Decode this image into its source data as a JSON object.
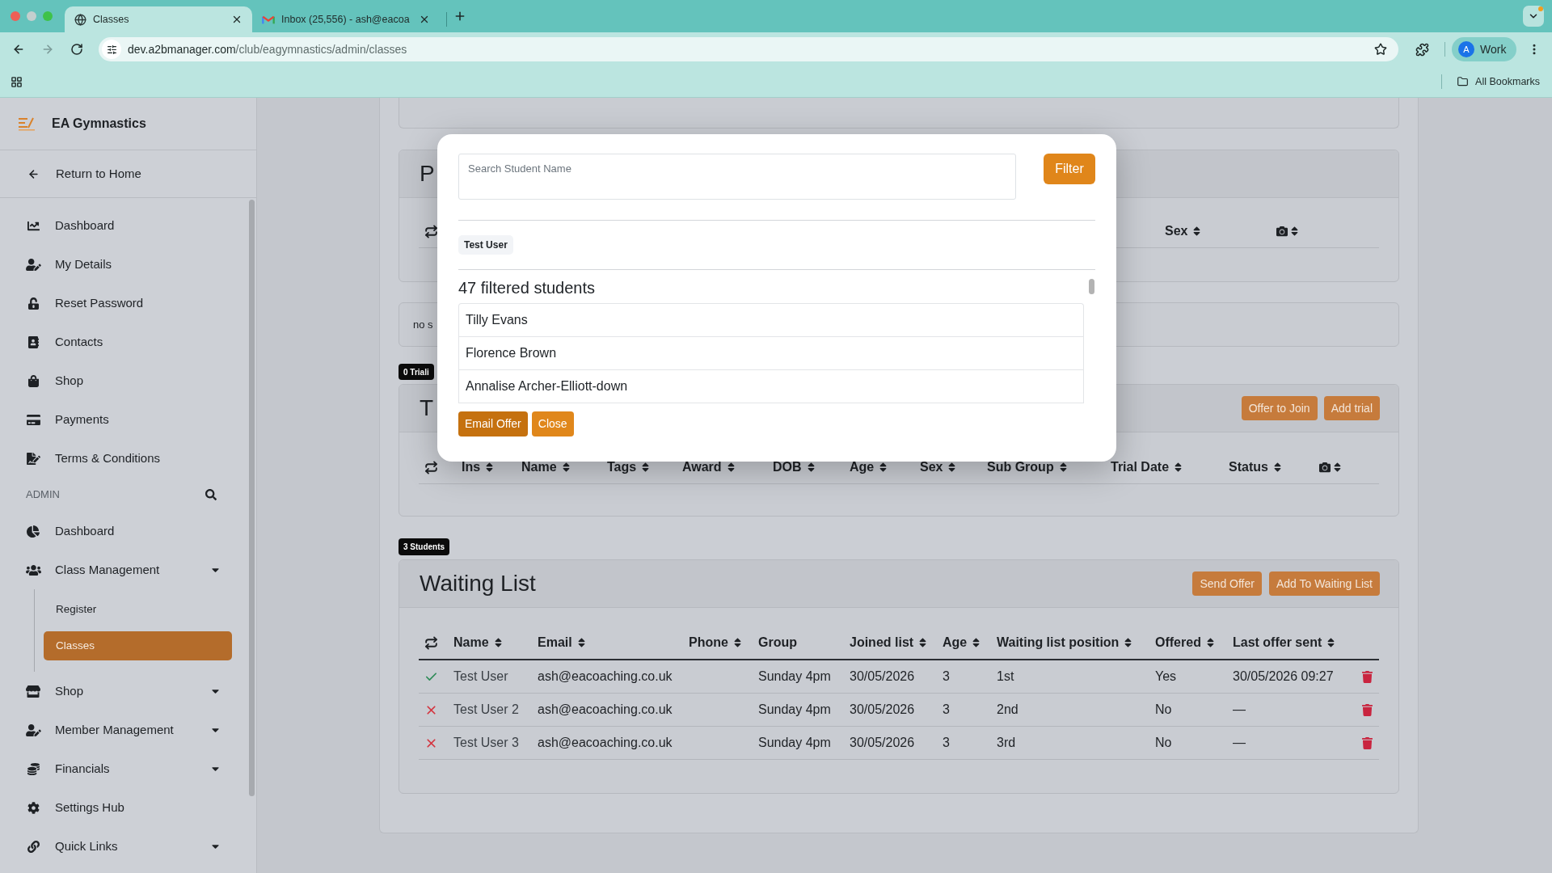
{
  "browser": {
    "tabs": [
      {
        "title": "Classes",
        "selected": true
      },
      {
        "title": "Inbox (25,556) - ash@eacoa",
        "selected": false
      }
    ],
    "url": {
      "host": "dev.a2bmanager.com",
      "path": "/club/eagymnastics/admin/classes"
    },
    "profile": {
      "initial": "A",
      "name": "Work"
    },
    "bookmarks_folder": "All Bookmarks"
  },
  "sidebar": {
    "club_name": "EA Gymnastics",
    "back_link": "Return to Home",
    "items": [
      {
        "label": "Dashboard",
        "selected": false
      },
      {
        "label": "My Details",
        "selected": false
      },
      {
        "label": "Reset Password",
        "selected": false
      },
      {
        "label": "Contacts",
        "selected": false
      },
      {
        "label": "Shop",
        "selected": false
      },
      {
        "label": "Payments",
        "selected": false
      },
      {
        "label": "Terms & Conditions",
        "selected": false
      }
    ],
    "admin_label": "ADMIN",
    "admin_items": [
      {
        "label": "Dashboard",
        "selected": false
      },
      {
        "label": "Class Management",
        "selected": false,
        "expanded": true,
        "children": [
          {
            "label": "Register",
            "selected": false
          },
          {
            "label": "Classes",
            "selected": true
          }
        ]
      },
      {
        "label": "Shop",
        "selected": false,
        "expanded": false
      },
      {
        "label": "Member Management",
        "selected": false,
        "expanded": false
      },
      {
        "label": "Financials",
        "selected": false,
        "expanded": false
      },
      {
        "label": "Settings Hub",
        "selected": false
      },
      {
        "label": "Quick Links",
        "selected": false,
        "expanded": false
      }
    ]
  },
  "main": {
    "previous_card": {
      "title": "P",
      "columns": [
        {
          "label": "Sex",
          "sortable": true
        }
      ]
    },
    "notice": "no s",
    "trials": {
      "badge": "0 Triali",
      "title": "T",
      "buttons": [
        "Offer to Join",
        "Add trial"
      ],
      "columns": [
        {
          "label": "Ins",
          "sortable": true
        },
        {
          "label": "Name",
          "sortable": true
        },
        {
          "label": "Tags",
          "sortable": true
        },
        {
          "label": "Award",
          "sortable": true
        },
        {
          "label": "DOB",
          "sortable": true
        },
        {
          "label": "Age",
          "sortable": true
        },
        {
          "label": "Sex",
          "sortable": true
        },
        {
          "label": "Sub Group",
          "sortable": true
        },
        {
          "label": "Trial Date",
          "sortable": true
        },
        {
          "label": "Status",
          "sortable": true
        }
      ]
    },
    "waiting_list": {
      "badge": "3 Students",
      "title": "Waiting List",
      "buttons": [
        "Send Offer",
        "Add To Waiting List"
      ],
      "columns": [
        {
          "label": "Name",
          "sortable": true
        },
        {
          "label": "Email",
          "sortable": true
        },
        {
          "label": "Phone",
          "sortable": true
        },
        {
          "label": "Group",
          "sortable": false
        },
        {
          "label": "Joined list",
          "sortable": true
        },
        {
          "label": "Age",
          "sortable": true
        },
        {
          "label": "Waiting list position",
          "sortable": true
        },
        {
          "label": "Offered",
          "sortable": true
        },
        {
          "label": "Last offer sent",
          "sortable": true
        }
      ],
      "rows": [
        {
          "ticked": true,
          "name": "Test User",
          "email": "ash@eacoaching.co.uk",
          "group": "Sunday 4pm",
          "joined": "30/05/2026",
          "age": "3",
          "position": "1st",
          "offered": "Yes",
          "last_offer_sent": "30/05/2026 09:27"
        },
        {
          "ticked": false,
          "name": "Test User 2",
          "email": "ash@eacoaching.co.uk",
          "group": "Sunday 4pm",
          "joined": "30/05/2026",
          "age": "3",
          "position": "2nd",
          "offered": "No",
          "last_offer_sent": "—"
        },
        {
          "ticked": false,
          "name": "Test User 3",
          "email": "ash@eacoaching.co.uk",
          "group": "Sunday 4pm",
          "joined": "30/05/2026",
          "age": "3",
          "position": "3rd",
          "offered": "No",
          "last_offer_sent": "—"
        }
      ]
    }
  },
  "modal": {
    "search": {
      "placeholder": "Search Student Name"
    },
    "filter_button": "Filter",
    "chips": [
      "Test User"
    ],
    "count": "47 filtered students",
    "students": [
      "Tilly Evans",
      "Florence Brown",
      "Annalise Archer-Elliott-down"
    ],
    "buttons": [
      {
        "label": "Email Offer",
        "hovered": true
      },
      {
        "label": "Close",
        "hovered": false
      }
    ]
  }
}
